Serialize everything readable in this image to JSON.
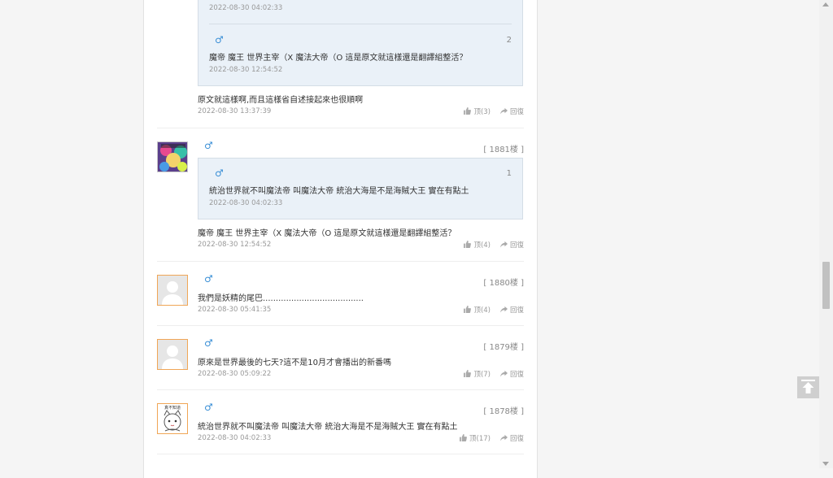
{
  "thread": {
    "top": {
      "quote": {
        "first_date": "2022-08-30 04:02:33",
        "male": "♂",
        "num": "2",
        "text": "魔帝 魔王 世界主宰（X 魔法大帝（O 這是原文就這樣還是翻譯組整活？",
        "date": "2022-08-30 12:54:52"
      },
      "text": "原文就這樣啊,而且這樣省自述接起來也很順啊",
      "date": "2022-08-30 13:37:39",
      "up": "顶(3)",
      "reply": "回復"
    },
    "c1881": {
      "male": "♂",
      "floor": "[ 1881楼 ]",
      "quote": {
        "male": "♂",
        "num": "1",
        "text": "統治世界就不叫魔法帝 叫魔法大帝 統治大海是不是海賊大王 實在有點土",
        "date": "2022-08-30 04:02:33"
      },
      "text": "魔帝 魔王 世界主宰（X 魔法大帝（O 這是原文就這樣還是翻譯組整活？",
      "date": "2022-08-30 12:54:52",
      "up": "顶(4)",
      "reply": "回復"
    },
    "c1880": {
      "male": "♂",
      "floor": "[ 1880楼 ]",
      "text": "我們是妖精的尾巴.......................................",
      "date": "2022-08-30 05:41:35",
      "up": "顶(4)",
      "reply": "回復"
    },
    "c1879": {
      "male": "♂",
      "floor": "[ 1879楼 ]",
      "text": "原來是世界最後的七天?這不是10月才會播出的新番嗎",
      "date": "2022-08-30 05:09:22",
      "up": "顶(7)",
      "reply": "回復"
    },
    "c1878": {
      "male": "♂",
      "floor": "[ 1878楼 ]",
      "avatar_caption": "真不知道",
      "text": "統治世界就不叫魔法帝 叫魔法大帝 統治大海是不是海賊大王 實在有點土",
      "date": "2022-08-30 04:02:33",
      "up": "顶(17)",
      "reply": "回復"
    }
  },
  "colors": {
    "male_icon": "#3a8fd6",
    "quote_bg": "#eaf1f8",
    "avatar_border": "#f0a656"
  },
  "icons": {
    "up": "thumbs-up-icon",
    "reply": "share-arrow-icon",
    "to_top": "arrow-up-icon"
  }
}
